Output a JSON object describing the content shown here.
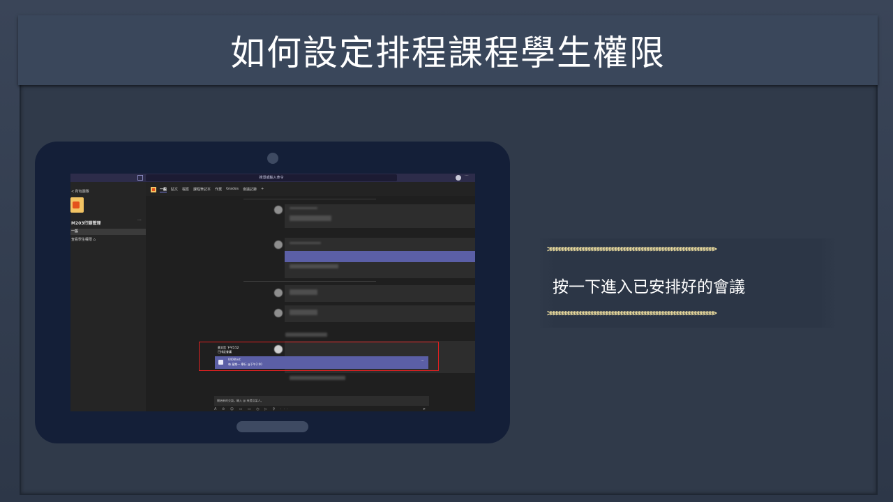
{
  "slide": {
    "title": "如何設定排程課程學生權限",
    "note_text": "按一下進入已安排好的會議",
    "arrow_line": ">>>>>>>>>>>>>>>>>>>>>>>>>>>>>>>>>>>>>>>>>>>>>>>>>>>>>>>>>"
  },
  "teams": {
    "search_placeholder": "搜尋或輸入命令",
    "back_label": "< 所有團隊",
    "team_name": "M203行銷管理",
    "team_more": "···",
    "channel_selected": "一般",
    "channel_other": "查看學生權限 ⌂",
    "tabs": [
      "一般",
      "貼文",
      "檔案",
      "課程筆記本",
      "作業",
      "Grades",
      "會議記錄",
      "+"
    ],
    "post": {
      "author": "蔡文哲  下午5:52",
      "message": "已排定會議"
    },
    "meeting": {
      "name": "0406test",
      "time": "每 星期一 舉行 @下午2:00",
      "more": "···"
    },
    "composer_placeholder": "開始新的交談。輸入 @ 來提及某人。",
    "composer_tools": "A ⊘ ☺ ▭ ▭ ◷ ▷ ♀ ··· ",
    "send_icon": "➤"
  },
  "colors": {
    "slide_background": "#2c3545",
    "title_bar": "#3a475b",
    "tablet": "#141f38",
    "teams_purple": "#5b5fa6",
    "highlight_red": "#e02020",
    "arrow_gold": "#f0e0a0"
  }
}
